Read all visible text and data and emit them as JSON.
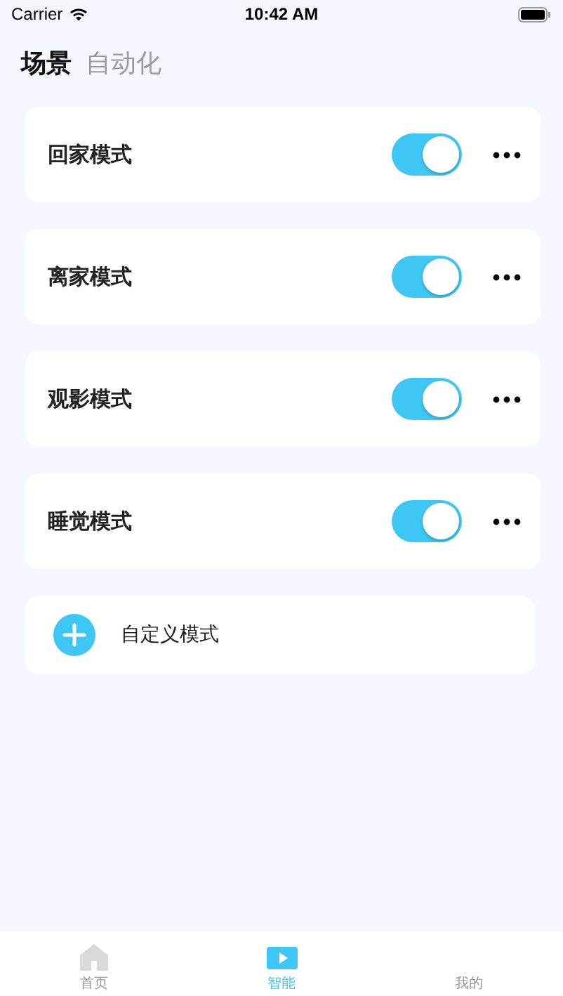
{
  "status_bar": {
    "carrier": "Carrier",
    "time": "10:42 AM"
  },
  "tabs": [
    {
      "label": "场景",
      "selected": true
    },
    {
      "label": "自动化",
      "selected": false
    }
  ],
  "scenes": [
    {
      "name": "回家模式",
      "on": true
    },
    {
      "name": "离家模式",
      "on": true
    },
    {
      "name": "观影模式",
      "on": true
    },
    {
      "name": "睡觉模式",
      "on": true
    }
  ],
  "add_scene": {
    "label": "自定义模式"
  },
  "tab_bar": [
    {
      "label": "首页",
      "kind": "home",
      "selected": false
    },
    {
      "label": "智能",
      "kind": "smart",
      "selected": true
    },
    {
      "label": "我的",
      "kind": "none",
      "selected": false
    }
  ]
}
